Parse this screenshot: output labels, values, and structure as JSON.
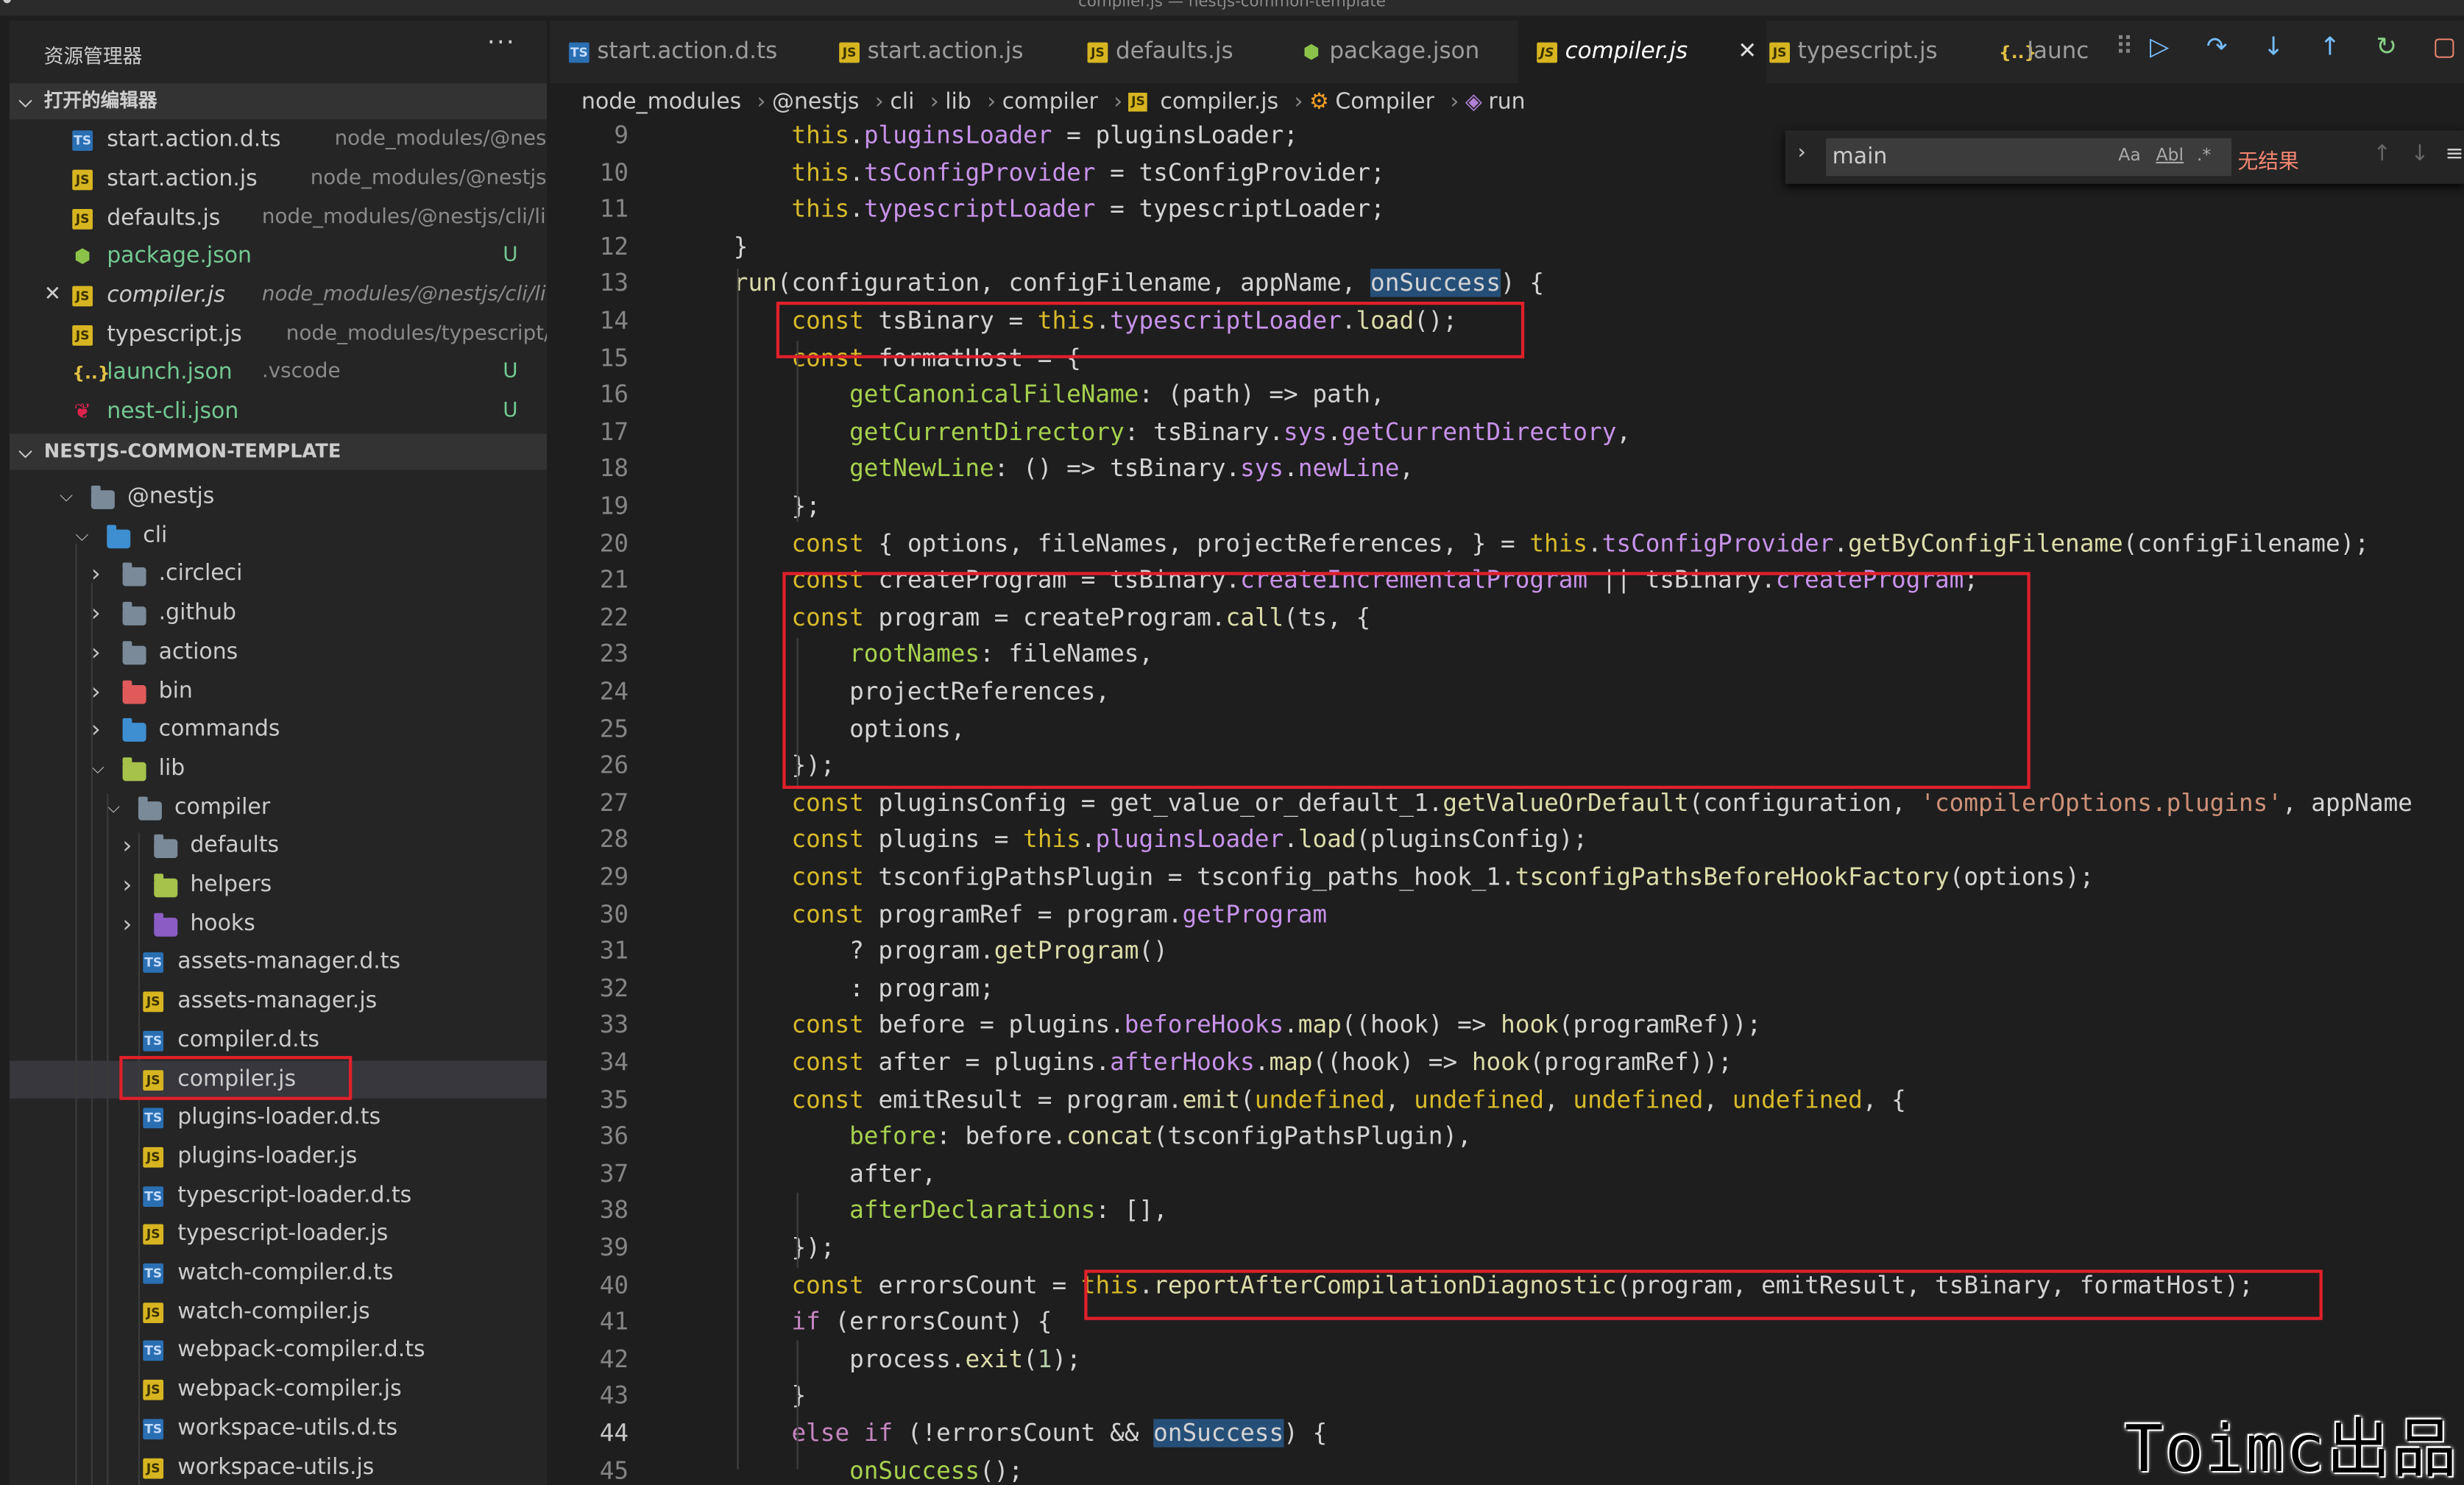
{
  "window": {
    "title": "compiler.js — nestjs-common-template"
  },
  "sidebar": {
    "title": "资源管理器",
    "more": "···",
    "open_editors_title": "打开的编辑器",
    "open_editors": [
      {
        "name": "start.action.d.ts",
        "path": "node_modules/@nestjs/cl...",
        "icon": "ts-file-icon"
      },
      {
        "name": "start.action.js",
        "path": "node_modules/@nestjs/cli/a...",
        "icon": "js-file-icon"
      },
      {
        "name": "defaults.js",
        "path": "node_modules/@nestjs/cli/lib/c...",
        "icon": "js-file-icon"
      },
      {
        "name": "package.json",
        "path": "",
        "badge": "U",
        "icon": "npm-icon"
      },
      {
        "name": "compiler.js",
        "path": "node_modules/@nestjs/cli/lib/c...",
        "icon": "js-file-icon",
        "close": "✕"
      },
      {
        "name": "typescript.js",
        "path": "node_modules/typescript/lib",
        "icon": "js-file-icon"
      },
      {
        "name": "launch.json",
        "path": ".vscode",
        "badge": "U",
        "icon": "json-icon"
      },
      {
        "name": "nest-cli.json",
        "path": "",
        "badge": "U",
        "icon": "nest-icon"
      }
    ],
    "project_title": "NESTJS-COMMON-TEMPLATE",
    "tree": [
      {
        "name": "@nestjs",
        "kind": "folder"
      },
      {
        "name": "cli",
        "kind": "folder"
      },
      {
        "name": ".circleci",
        "kind": "folder"
      },
      {
        "name": ".github",
        "kind": "folder"
      },
      {
        "name": "actions",
        "kind": "folder"
      },
      {
        "name": "bin",
        "kind": "folder"
      },
      {
        "name": "commands",
        "kind": "folder"
      },
      {
        "name": "lib",
        "kind": "folder"
      },
      {
        "name": "compiler",
        "kind": "folder"
      },
      {
        "name": "defaults",
        "kind": "folder"
      },
      {
        "name": "helpers",
        "kind": "folder"
      },
      {
        "name": "hooks",
        "kind": "folder"
      },
      {
        "name": "assets-manager.d.ts",
        "kind": "ts"
      },
      {
        "name": "assets-manager.js",
        "kind": "js"
      },
      {
        "name": "compiler.d.ts",
        "kind": "ts"
      },
      {
        "name": "compiler.js",
        "kind": "js",
        "selected": true
      },
      {
        "name": "plugins-loader.d.ts",
        "kind": "ts"
      },
      {
        "name": "plugins-loader.js",
        "kind": "js"
      },
      {
        "name": "typescript-loader.d.ts",
        "kind": "ts"
      },
      {
        "name": "typescript-loader.js",
        "kind": "js"
      },
      {
        "name": "watch-compiler.d.ts",
        "kind": "ts"
      },
      {
        "name": "watch-compiler.js",
        "kind": "js"
      },
      {
        "name": "webpack-compiler.d.ts",
        "kind": "ts"
      },
      {
        "name": "webpack-compiler.js",
        "kind": "js"
      },
      {
        "name": "workspace-utils.d.ts",
        "kind": "ts"
      },
      {
        "name": "workspace-utils.js",
        "kind": "js"
      }
    ]
  },
  "tabs": [
    {
      "label": "start.action.d.ts",
      "icon": "ts-file-icon"
    },
    {
      "label": "start.action.js",
      "icon": "js-file-icon"
    },
    {
      "label": "defaults.js",
      "icon": "js-file-icon"
    },
    {
      "label": "package.json",
      "icon": "npm-icon"
    },
    {
      "label": "compiler.js",
      "icon": "js-file-icon",
      "active": true,
      "close": "✕"
    },
    {
      "label": "typescript.js",
      "icon": "js-file-icon"
    },
    {
      "label": "launc",
      "icon": "json-icon"
    }
  ],
  "debug_toolbar": [
    "grip-icon",
    "continue-icon",
    "step-over-icon",
    "step-into-icon",
    "step-out-icon",
    "restart-icon",
    "stop-icon"
  ],
  "breadcrumb": [
    "node_modules",
    "@nestjs",
    "cli",
    "lib",
    "compiler",
    "compiler.js",
    "Compiler",
    "run"
  ],
  "find": {
    "value": "main",
    "opt_case": "Aa",
    "opt_word": "Abl",
    "opt_regex": ".*",
    "result": "无结果"
  },
  "editor": {
    "current_line": 44,
    "lines": [
      {
        "n": 9
      },
      {
        "n": 10
      },
      {
        "n": 11
      },
      {
        "n": 12
      },
      {
        "n": 13
      },
      {
        "n": 14
      },
      {
        "n": 15
      },
      {
        "n": 16
      },
      {
        "n": 17
      },
      {
        "n": 18
      },
      {
        "n": 19
      },
      {
        "n": 20
      },
      {
        "n": 21
      },
      {
        "n": 22
      },
      {
        "n": 23
      },
      {
        "n": 24
      },
      {
        "n": 25
      },
      {
        "n": 26
      },
      {
        "n": 27
      },
      {
        "n": 28
      },
      {
        "n": 29
      },
      {
        "n": 30
      },
      {
        "n": 31
      },
      {
        "n": 32
      },
      {
        "n": 33
      },
      {
        "n": 34
      },
      {
        "n": 35
      },
      {
        "n": 36
      },
      {
        "n": 37
      },
      {
        "n": 38
      },
      {
        "n": 39
      },
      {
        "n": 40
      },
      {
        "n": 41
      },
      {
        "n": 42
      },
      {
        "n": 43
      },
      {
        "n": 44
      },
      {
        "n": 45
      }
    ],
    "code": [
      [
        [
          "        ",
          "v"
        ],
        [
          "this",
          "k"
        ],
        [
          ".",
          "v"
        ],
        [
          "pluginsLoader",
          "pr"
        ],
        [
          " = pluginsLoader;",
          "v"
        ]
      ],
      [
        [
          "        ",
          "v"
        ],
        [
          "this",
          "k"
        ],
        [
          ".",
          "v"
        ],
        [
          "tsConfigProvider",
          "pr"
        ],
        [
          " = tsConfigProvider;",
          "v"
        ]
      ],
      [
        [
          "        ",
          "v"
        ],
        [
          "this",
          "k"
        ],
        [
          ".",
          "v"
        ],
        [
          "typescriptLoader",
          "pr"
        ],
        [
          " = typescriptLoader;",
          "v"
        ]
      ],
      [
        [
          "    }",
          "v"
        ]
      ],
      [
        [
          "    ",
          "v"
        ],
        [
          "run",
          "f"
        ],
        [
          "(configuration, configFilename, appName, ",
          "v"
        ],
        [
          "onSuccess",
          "hl"
        ],
        [
          ") {",
          "v"
        ]
      ],
      [
        [
          "        ",
          "v"
        ],
        [
          "const",
          "k"
        ],
        [
          " tsBinary = ",
          "v"
        ],
        [
          "this",
          "k"
        ],
        [
          ".",
          "v"
        ],
        [
          "typescriptLoader",
          "pr"
        ],
        [
          ".",
          "v"
        ],
        [
          "load",
          "f"
        ],
        [
          "();",
          "v"
        ]
      ],
      [
        [
          "        ",
          "v"
        ],
        [
          "const",
          "k"
        ],
        [
          " formatHost = {",
          "v"
        ]
      ],
      [
        [
          "            ",
          "v"
        ],
        [
          "getCanonicalFileName",
          "g"
        ],
        [
          ": (path) => path,",
          "v"
        ]
      ],
      [
        [
          "            ",
          "v"
        ],
        [
          "getCurrentDirectory",
          "g"
        ],
        [
          ": tsBinary.",
          "v"
        ],
        [
          "sys",
          "pr"
        ],
        [
          ".",
          "v"
        ],
        [
          "getCurrentDirectory",
          "pr"
        ],
        [
          ",",
          "v"
        ]
      ],
      [
        [
          "            ",
          "v"
        ],
        [
          "getNewLine",
          "g"
        ],
        [
          ": () => tsBinary.",
          "v"
        ],
        [
          "sys",
          "pr"
        ],
        [
          ".",
          "v"
        ],
        [
          "newLine",
          "pr"
        ],
        [
          ",",
          "v"
        ]
      ],
      [
        [
          "        };",
          "v"
        ]
      ],
      [
        [
          "        ",
          "v"
        ],
        [
          "const",
          "k"
        ],
        [
          " { options, fileNames, projectReferences, } = ",
          "v"
        ],
        [
          "this",
          "k"
        ],
        [
          ".",
          "v"
        ],
        [
          "tsConfigProvider",
          "pr"
        ],
        [
          ".",
          "v"
        ],
        [
          "getByConfigFilename",
          "f"
        ],
        [
          "(configFilename);",
          "v"
        ]
      ],
      [
        [
          "        ",
          "v"
        ],
        [
          "const",
          "k"
        ],
        [
          " createProgram = tsBinary.",
          "v"
        ],
        [
          "createIncrementalProgram",
          "pr"
        ],
        [
          " || tsBinary.",
          "v"
        ],
        [
          "createProgram",
          "pr"
        ],
        [
          ";",
          "v"
        ]
      ],
      [
        [
          "        ",
          "v"
        ],
        [
          "const",
          "k"
        ],
        [
          " program = createProgram.",
          "v"
        ],
        [
          "call",
          "f"
        ],
        [
          "(ts, {",
          "v"
        ]
      ],
      [
        [
          "            ",
          "v"
        ],
        [
          "rootNames",
          "g"
        ],
        [
          ": fileNames,",
          "v"
        ]
      ],
      [
        [
          "            projectReferences,",
          "v"
        ]
      ],
      [
        [
          "            options,",
          "v"
        ]
      ],
      [
        [
          "        });",
          "v"
        ]
      ],
      [
        [
          "        ",
          "v"
        ],
        [
          "const",
          "k"
        ],
        [
          " pluginsConfig = get_value_or_default_1.",
          "v"
        ],
        [
          "getValueOrDefault",
          "f"
        ],
        [
          "(configuration, ",
          "v"
        ],
        [
          "'compilerOptions.plugins'",
          "s"
        ],
        [
          ", appName",
          "v"
        ]
      ],
      [
        [
          "        ",
          "v"
        ],
        [
          "const",
          "k"
        ],
        [
          " plugins = ",
          "v"
        ],
        [
          "this",
          "k"
        ],
        [
          ".",
          "v"
        ],
        [
          "pluginsLoader",
          "pr"
        ],
        [
          ".",
          "v"
        ],
        [
          "load",
          "f"
        ],
        [
          "(pluginsConfig);",
          "v"
        ]
      ],
      [
        [
          "        ",
          "v"
        ],
        [
          "const",
          "k"
        ],
        [
          " tsconfigPathsPlugin = tsconfig_paths_hook_1.",
          "v"
        ],
        [
          "tsconfigPathsBeforeHookFactory",
          "f"
        ],
        [
          "(options);",
          "v"
        ]
      ],
      [
        [
          "        ",
          "v"
        ],
        [
          "const",
          "k"
        ],
        [
          " programRef = program.",
          "v"
        ],
        [
          "getProgram",
          "pr"
        ]
      ],
      [
        [
          "            ? program.",
          "v"
        ],
        [
          "getProgram",
          "f"
        ],
        [
          "()",
          "v"
        ]
      ],
      [
        [
          "            : program;",
          "v"
        ]
      ],
      [
        [
          "        ",
          "v"
        ],
        [
          "const",
          "k"
        ],
        [
          " before = plugins.",
          "v"
        ],
        [
          "beforeHooks",
          "pr"
        ],
        [
          ".",
          "v"
        ],
        [
          "map",
          "f"
        ],
        [
          "((hook) => ",
          "v"
        ],
        [
          "hook",
          "f"
        ],
        [
          "(programRef));",
          "v"
        ]
      ],
      [
        [
          "        ",
          "v"
        ],
        [
          "const",
          "k"
        ],
        [
          " after = plugins.",
          "v"
        ],
        [
          "afterHooks",
          "pr"
        ],
        [
          ".",
          "v"
        ],
        [
          "map",
          "f"
        ],
        [
          "((hook) => ",
          "v"
        ],
        [
          "hook",
          "f"
        ],
        [
          "(programRef));",
          "v"
        ]
      ],
      [
        [
          "        ",
          "v"
        ],
        [
          "const",
          "k"
        ],
        [
          " emitResult = program.",
          "v"
        ],
        [
          "emit",
          "f"
        ],
        [
          "(",
          "v"
        ],
        [
          "undefined",
          "k"
        ],
        [
          ", ",
          "v"
        ],
        [
          "undefined",
          "k"
        ],
        [
          ", ",
          "v"
        ],
        [
          "undefined",
          "k"
        ],
        [
          ", ",
          "v"
        ],
        [
          "undefined",
          "k"
        ],
        [
          ", {",
          "v"
        ]
      ],
      [
        [
          "            ",
          "v"
        ],
        [
          "before",
          "g"
        ],
        [
          ": before.",
          "v"
        ],
        [
          "concat",
          "f"
        ],
        [
          "(tsconfigPathsPlugin),",
          "v"
        ]
      ],
      [
        [
          "            after,",
          "v"
        ]
      ],
      [
        [
          "            ",
          "v"
        ],
        [
          "afterDeclarations",
          "g"
        ],
        [
          ": [],",
          "v"
        ]
      ],
      [
        [
          "        });",
          "v"
        ]
      ],
      [
        [
          "        ",
          "v"
        ],
        [
          "const",
          "k"
        ],
        [
          " errorsCount = ",
          "v"
        ],
        [
          "this",
          "k"
        ],
        [
          ".",
          "v"
        ],
        [
          "reportAfterCompilationDiagnostic",
          "f"
        ],
        [
          "(program, emitResult, tsBinary, formatHost);",
          "v"
        ]
      ],
      [
        [
          "        ",
          "v"
        ],
        [
          "if",
          "p"
        ],
        [
          " (errorsCount) {",
          "v"
        ]
      ],
      [
        [
          "            process.",
          "v"
        ],
        [
          "exit",
          "f"
        ],
        [
          "(",
          "v"
        ],
        [
          "1",
          "t"
        ],
        [
          ");",
          "v"
        ]
      ],
      [
        [
          "        }",
          "v"
        ]
      ],
      [
        [
          "        ",
          "v"
        ],
        [
          "else",
          "p"
        ],
        [
          " ",
          "v"
        ],
        [
          "if",
          "p"
        ],
        [
          " (!errorsCount && ",
          "v"
        ],
        [
          "onSuccess",
          "hl"
        ],
        [
          ") {",
          "v"
        ]
      ],
      [
        [
          "            ",
          "v"
        ],
        [
          "onSuccess",
          "g"
        ],
        [
          "();",
          "v"
        ]
      ]
    ]
  },
  "watermark": "Toimc出品",
  "colors": {
    "highlight_box": "#e0202a",
    "accent": "#007acc"
  }
}
